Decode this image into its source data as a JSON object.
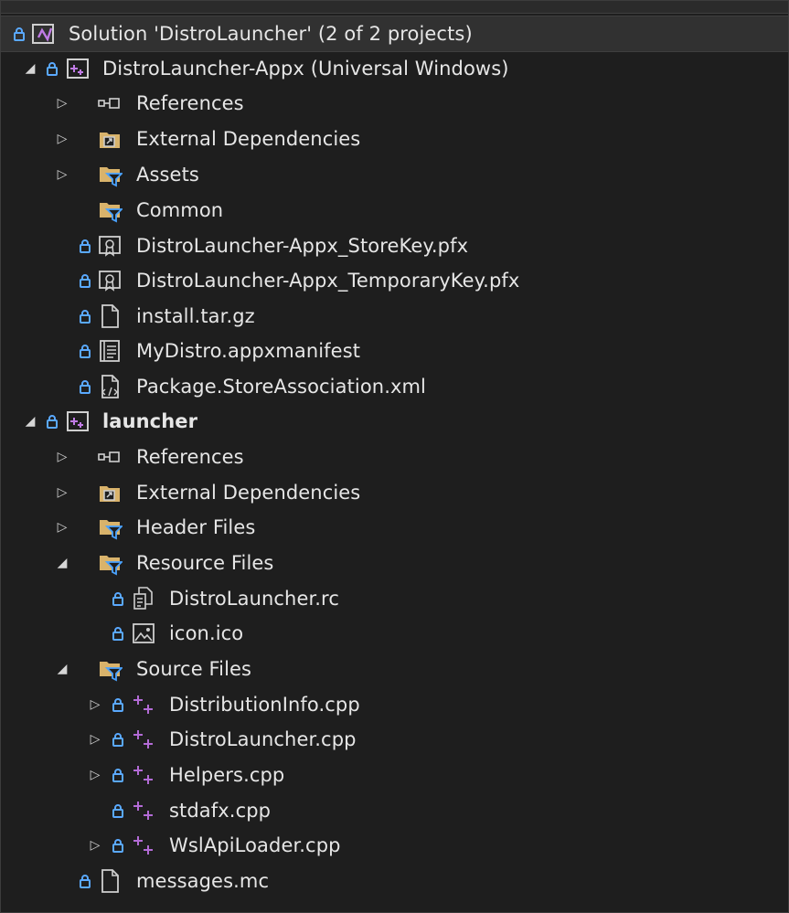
{
  "solution": {
    "label": "Solution 'DistroLauncher' (2 of 2 projects)"
  },
  "rows": [
    {
      "label": "DistroLauncher-Appx (Universal Windows)"
    },
    {
      "label": "References"
    },
    {
      "label": "External Dependencies"
    },
    {
      "label": "Assets"
    },
    {
      "label": "Common"
    },
    {
      "label": "DistroLauncher-Appx_StoreKey.pfx"
    },
    {
      "label": "DistroLauncher-Appx_TemporaryKey.pfx"
    },
    {
      "label": "install.tar.gz"
    },
    {
      "label": "MyDistro.appxmanifest"
    },
    {
      "label": "Package.StoreAssociation.xml"
    },
    {
      "label": "launcher"
    },
    {
      "label": "References"
    },
    {
      "label": "External Dependencies"
    },
    {
      "label": "Header Files"
    },
    {
      "label": "Resource Files"
    },
    {
      "label": "DistroLauncher.rc"
    },
    {
      "label": "icon.ico"
    },
    {
      "label": "Source Files"
    },
    {
      "label": "DistributionInfo.cpp"
    },
    {
      "label": "DistroLauncher.cpp"
    },
    {
      "label": "Helpers.cpp"
    },
    {
      "label": "stdafx.cpp"
    },
    {
      "label": "WslApiLoader.cpp"
    },
    {
      "label": "messages.mc"
    }
  ],
  "colors": {
    "background": "#1e1e1e",
    "selected_row": "#313131",
    "text": "#e6e6e6",
    "lock": "#5aa9ff",
    "folder": "#d9b36b",
    "filter": "#4aa3ff",
    "cpp_plus": "#b36bd6",
    "project": "#c07be6"
  }
}
